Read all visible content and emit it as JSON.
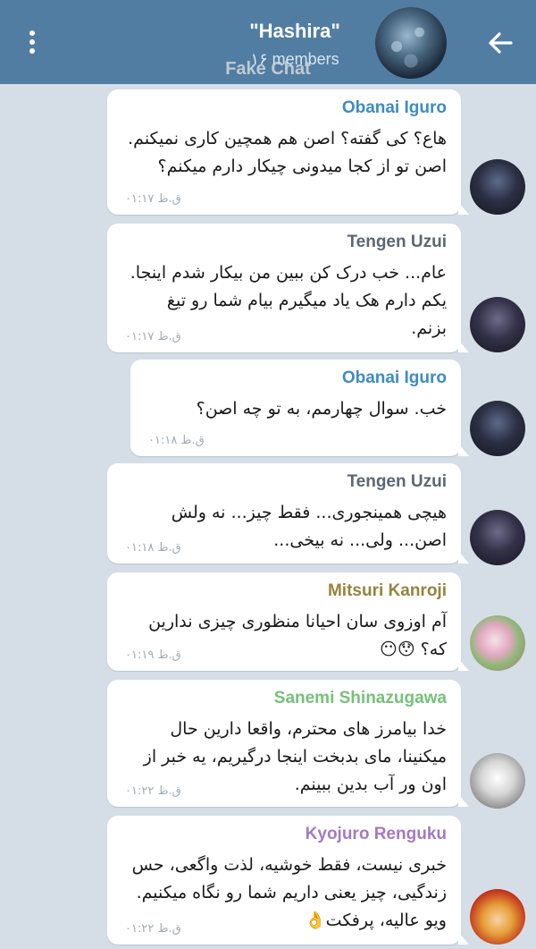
{
  "header": {
    "title": "\"Hashira\"",
    "subtitle": "۱۶ members",
    "watermark": "Fake Chat",
    "menu_icon": "vertical-dots-icon",
    "back_icon": "arrow-left-icon",
    "colors": {
      "header_bg": "#517da2",
      "chat_bg": "#d5dee6",
      "bubble_bg": "#ffffff"
    }
  },
  "messages": [
    {
      "sender": "Obanai Iguro",
      "sender_color": "#3f8cc1",
      "text": "هاع؟ کی گفته؟ اصن هم همچین کاری نمیکنم.\nاصن تو از کجا میدونی چیکار دارم میکنم؟",
      "time": "۰۱:۱۷ ق.ظ"
    },
    {
      "sender": "Tengen Uzui",
      "sender_color": "#5d6673",
      "text": "عام... خب درک کن ببین من بیکار شدم اینجا.\nیکم دارم هک یاد میگیرم بیام شما رو تیغ\nبزنم.",
      "time": "۰۱:۱۷ ق.ظ"
    },
    {
      "sender": "Obanai Iguro",
      "sender_color": "#3f8cc1",
      "text": "خب. سوال چهارمم، به تو چه اصن؟",
      "time": "۰۱:۱۸ ق.ظ"
    },
    {
      "sender": "Tengen Uzui",
      "sender_color": "#5d6673",
      "text": "هیچی همینجوری... فقط چیز... نه ولش\nاصن... ولی... نه بیخی...",
      "time": "۰۱:۱۸ ق.ظ"
    },
    {
      "sender": "Mitsuri Kanroji",
      "sender_color": "#94843f",
      "text": "آم اوزوی سان احیانا منظوری چیزی ندارین\nکه؟ 😯😶",
      "time": "۰۱:۱۹ ق.ظ"
    },
    {
      "sender": "Sanemi Shinazugawa",
      "sender_color": "#77c07a",
      "text": "خدا بیامرز های محترم، واقعا دارین حال\nمیکنینا، مای بدبخت اینجا درگیریم، یه خبر از\nاون ور آب بدین ببینم.",
      "time": "۰۱:۲۲ ق.ظ"
    },
    {
      "sender": "Kyojuro Renguku",
      "sender_color": "#a47ac0",
      "text": "خبری نیست، فقط خوشیه، لذت واگعی، حس\nزندگیی، چیز یعنی داریم شما رو نگاه میکنیم.\nویو عالیه، پرفکت👌",
      "time": "۰۱:۲۲ ق.ظ"
    }
  ]
}
